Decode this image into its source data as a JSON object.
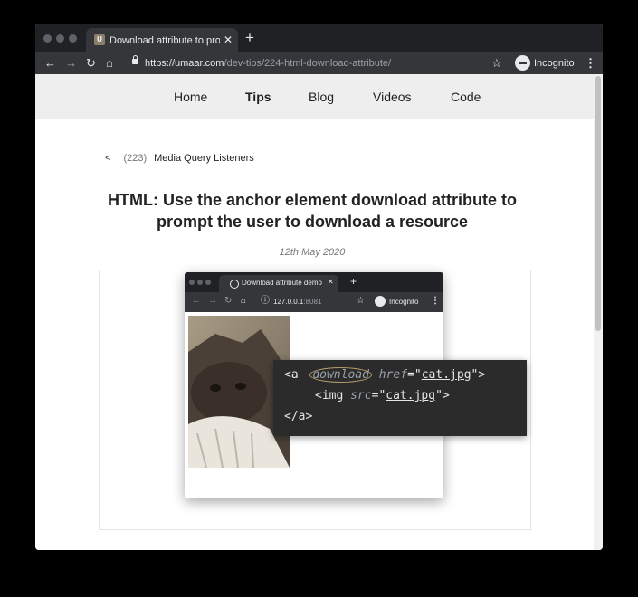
{
  "browser": {
    "tab_title": "Download attribute to prompt",
    "tab_favicon_letter": "U",
    "tab_close": "✕",
    "new_tab": "+",
    "url_host": "https://umaar.com",
    "url_path": "/dev-tips/224-html-download-attribute/",
    "incognito_label": "Incognito",
    "icons": {
      "back": "arrow-left-icon",
      "forward": "arrow-right-icon",
      "reload": "reload-icon",
      "home": "home-icon",
      "lock": "lock-icon",
      "bookmark": "star-icon",
      "incognito": "incognito-icon",
      "menu": "kebab-menu-icon"
    }
  },
  "site_nav": {
    "items": [
      {
        "label": "Home",
        "active": false
      },
      {
        "label": "Tips",
        "active": true
      },
      {
        "label": "Blog",
        "active": false
      },
      {
        "label": "Videos",
        "active": false
      },
      {
        "label": "Code",
        "active": false
      }
    ]
  },
  "article": {
    "prev_arrow": "<",
    "prev_number": "(223)",
    "prev_title": "Media Query Listeners",
    "title": "HTML: Use the anchor element download attribute to prompt the user to download a resource",
    "date": "12th May 2020"
  },
  "figure": {
    "mock_tab_title": "Download attribute demo",
    "mock_tab_close": "✕",
    "mock_new_tab": "+",
    "mock_url_host": "127.0.0.1",
    "mock_url_port": ":8081",
    "mock_incognito_label": "Incognito",
    "code": {
      "line1_open": "<a ",
      "line1_attr_download": "download",
      "line1_attr_href": "href",
      "line1_val_href": "cat.jpg",
      "line1_close": ">",
      "line2_open": "<img ",
      "line2_attr_src": "src",
      "line2_val_src": "cat.jpg",
      "line2_close": ">",
      "line3": "</a>"
    }
  },
  "colors": {
    "chrome_dark": "#202124",
    "chrome_toolbar": "#35363a",
    "nav_background": "#eeeeee",
    "code_background": "#2b2b2b"
  }
}
